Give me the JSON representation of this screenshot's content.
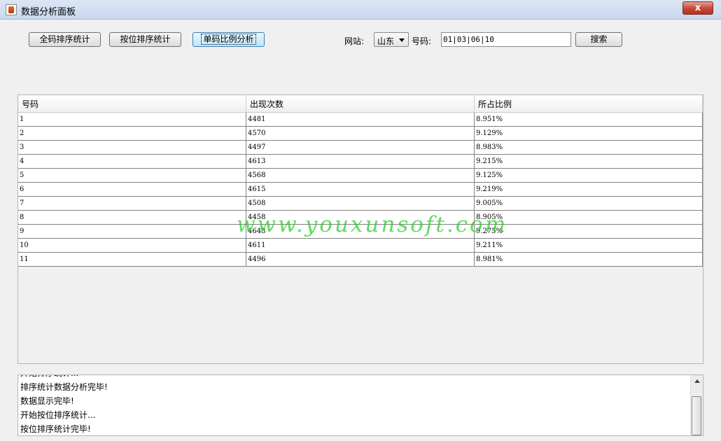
{
  "window": {
    "title": "数据分析面板",
    "close_label": "x"
  },
  "toolbar": {
    "btn_all_sort": "全码排序统计",
    "btn_pos_sort": "按位排序统计",
    "btn_ratio": "单码比例分析",
    "site_label": "网站:",
    "site_value": "山东",
    "number_label": "号码:",
    "number_value": "01|03|06|10",
    "search_label": "搜索"
  },
  "table": {
    "headers": [
      "号码",
      "出现次数",
      "所占比例"
    ],
    "rows": [
      [
        "1",
        "4481",
        "8.951%"
      ],
      [
        "2",
        "4570",
        "9.129%"
      ],
      [
        "3",
        "4497",
        "8.983%"
      ],
      [
        "4",
        "4613",
        "9.215%"
      ],
      [
        "5",
        "4568",
        "9.125%"
      ],
      [
        "6",
        "4615",
        "9.219%"
      ],
      [
        "7",
        "4508",
        "9.005%"
      ],
      [
        "8",
        "4458",
        "8.905%"
      ],
      [
        "9",
        "4643",
        "9.275%"
      ],
      [
        "10",
        "4611",
        "9.211%"
      ],
      [
        "11",
        "4496",
        "8.981%"
      ]
    ]
  },
  "log": {
    "lines": [
      "开始排序统计...",
      "排序统计数据分析完毕!",
      "数据显示完毕!",
      "开始按位排序统计...",
      "按位排序统计完毕!"
    ]
  },
  "watermark": "www.youxunsoft.com"
}
